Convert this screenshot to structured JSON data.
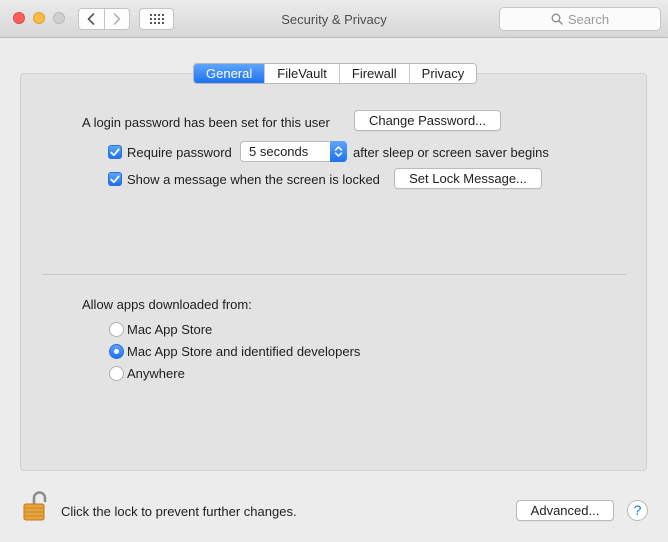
{
  "window": {
    "title": "Security & Privacy",
    "search_placeholder": "Search"
  },
  "tabs": [
    {
      "label": "General",
      "active": true
    },
    {
      "label": "FileVault",
      "active": false
    },
    {
      "label": "Firewall",
      "active": false
    },
    {
      "label": "Privacy",
      "active": false
    }
  ],
  "general": {
    "login_text": "A login password has been set for this user",
    "change_password_label": "Change Password...",
    "require_password": {
      "checked": true,
      "label": "Require password",
      "delay_value": "5 seconds",
      "suffix": "after sleep or screen saver begins"
    },
    "show_message": {
      "checked": true,
      "label": "Show a message when the screen is locked",
      "button_label": "Set Lock Message..."
    },
    "allow_apps": {
      "label": "Allow apps downloaded from:",
      "options": [
        {
          "label": "Mac App Store",
          "selected": false
        },
        {
          "label": "Mac App Store and identified developers",
          "selected": true
        },
        {
          "label": "Anywhere",
          "selected": false
        }
      ]
    }
  },
  "footer": {
    "lock_text": "Click the lock to prevent further changes.",
    "advanced_label": "Advanced...",
    "help_label": "?"
  },
  "colors": {
    "accent": "#1d72f2",
    "lock_gold": "#e8a33a"
  }
}
